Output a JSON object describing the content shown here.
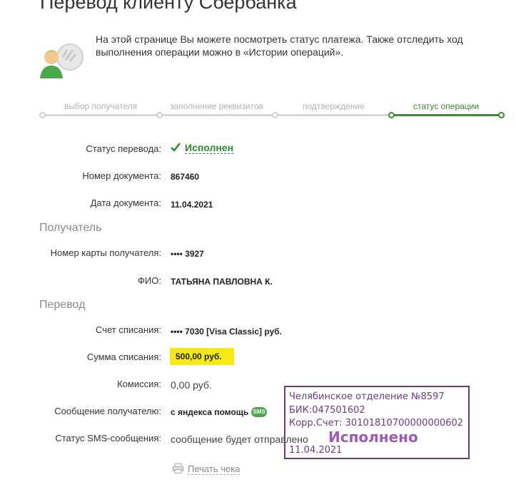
{
  "page": {
    "title": "Перевод клиенту Сбербанка",
    "intro": "На этой странице Вы можете посмотреть статус платежа. Также отследить ход выполнения операции можно в «Истории операций»."
  },
  "steps": [
    {
      "label": "выбор получателя",
      "active": false
    },
    {
      "label": "заполнение реквизитов",
      "active": false
    },
    {
      "label": "подтверждение",
      "active": false
    },
    {
      "label": "статус операции",
      "active": true
    }
  ],
  "details": {
    "status_label": "Статус перевода:",
    "status_value": "Исполнен",
    "doc_number_label": "Номер документа:",
    "doc_number_value": "867460",
    "doc_date_label": "Дата документа:",
    "doc_date_value": "11.04.2021"
  },
  "recipient": {
    "section_title": "Получатель",
    "card_label": "Номер карты получателя:",
    "card_value": "•••• 3927",
    "name_label": "ФИО:",
    "name_value": "ТАТЬЯНА ПАВЛОВНА К."
  },
  "transfer": {
    "section_title": "Перевод",
    "account_label": "Счет списания:",
    "account_value": "•••• 7030  [Visa Classic]  руб.",
    "amount_label": "Сумма списания:",
    "amount_value": "500,00  руб.",
    "commission_label": "Комиссия:",
    "commission_value": "0,00 руб.",
    "message_label": "Сообщение получателю:",
    "message_value": "с яндекса помощь",
    "sms_icon_text": "SMS",
    "sms_status_label": "Статус SMS-сообщения:",
    "sms_status_value": "сообщение будет отправлено"
  },
  "print": {
    "label": "Печать чека"
  },
  "stamp": {
    "branch": "Челябинское отделение №8597",
    "bik": "БИК:047501602",
    "corr": "Корр.Счет: 30101810700000000602",
    "status": "Исполнено",
    "date": "11.04.2021"
  },
  "colors": {
    "accent_green": "#3d8a34",
    "highlight_yellow": "#f6e817",
    "stamp_purple": "#6b3a7f"
  }
}
